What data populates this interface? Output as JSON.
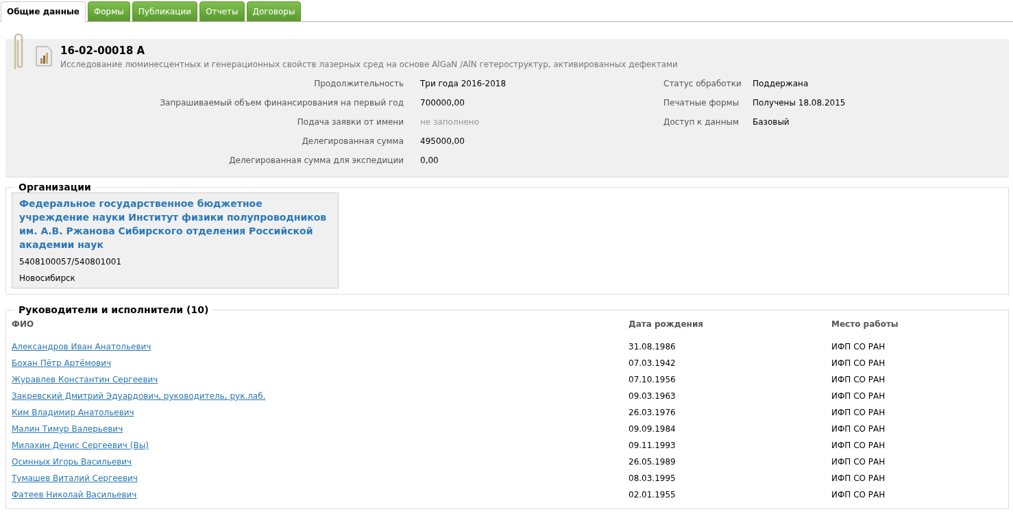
{
  "tabs": [
    {
      "label": "Общие данные",
      "selected": true
    },
    {
      "label": "Формы",
      "selected": false
    },
    {
      "label": "Публикации",
      "selected": false
    },
    {
      "label": "Отчеты",
      "selected": false
    },
    {
      "label": "Договоры",
      "selected": false
    }
  ],
  "project": {
    "number": "16-02-00018 А",
    "title": "Исследование люминесцентных и генерационных свойств лазерных сред на основе AlGaN /AlN гетероструктур, активированных дефектами",
    "fields_left": [
      {
        "label": "Продолжительность",
        "value": "Три года 2016-2018",
        "muted": false
      },
      {
        "label": "Запрашиваемый объем финансирования на первый год",
        "value": "700000,00",
        "muted": false
      },
      {
        "label": "Подача заявки от имени",
        "value": "не заполнено",
        "muted": true
      },
      {
        "label": "Делегированная сумма",
        "value": "495000,00",
        "muted": false
      },
      {
        "label": "Делегированная сумма для экспедиции",
        "value": "0,00",
        "muted": false
      }
    ],
    "fields_right": [
      {
        "label": "Статус обработки",
        "value": "Поддержана",
        "muted": false
      },
      {
        "label": "Печатные формы",
        "value": "Получены 18.08.2015",
        "muted": false
      },
      {
        "label": "Доступ к данным",
        "value": "Базовый",
        "muted": false
      }
    ]
  },
  "organizations": {
    "title": "Организации",
    "items": [
      {
        "name": "Федеральное государственное бюджетное учреждение науки Институт физики полупроводников им. А.В. Ржанова Сибирского отделения Российской академии наук",
        "codes": "5408100057/540801001",
        "city": "Новосибирск"
      }
    ]
  },
  "people": {
    "title": "Руководители и исполнители (10)",
    "columns": [
      "ФИО",
      "Дата рождения",
      "Место работы"
    ],
    "rows": [
      [
        "Александров Иван Анатольевич",
        "31.08.1986",
        "ИФП СО РАН"
      ],
      [
        "Бохан Пётр Артёмович",
        "07.03.1942",
        "ИФП СО РАН"
      ],
      [
        "Журавлев Константин Сергеевич",
        "07.10.1956",
        "ИФП СО РАН"
      ],
      [
        "Закревский Дмитрий Эдуардович, руководитель, рук.лаб.",
        "09.03.1963",
        "ИФП СО РАН"
      ],
      [
        "Ким Владимир Анатольевич",
        "26.03.1976",
        "ИФП СО РАН"
      ],
      [
        "Малин Тимур Валерьевич",
        "09.09.1984",
        "ИФП СО РАН"
      ],
      [
        "Милахин Денис Сергеевич (Вы)",
        "09.11.1993",
        "ИФП СО РАН"
      ],
      [
        "Осинных Игорь Васильевич",
        "26.05.1989",
        "ИФП СО РАН"
      ],
      [
        "Тумашев Виталий Сергеевич",
        "08.03.1995",
        "ИФП СО РАН"
      ],
      [
        "Фатеев Николай Васильевич",
        "02.01.1955",
        "ИФП СО РАН"
      ]
    ]
  }
}
